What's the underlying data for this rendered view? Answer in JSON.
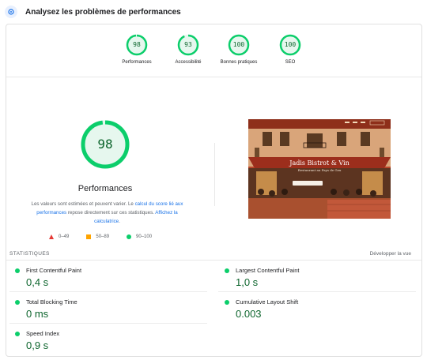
{
  "header": {
    "title": "Analysez les problèmes de performances",
    "icon": "lighthouse-icon"
  },
  "gauges": [
    {
      "label": "Performances",
      "value": "98",
      "score": 0.98
    },
    {
      "label": "Accessibilité",
      "value": "93",
      "score": 0.93
    },
    {
      "label": "Bonnes pratiques",
      "value": "100",
      "score": 1.0
    },
    {
      "label": "SEO",
      "value": "100",
      "score": 1.0
    }
  ],
  "main": {
    "score": "98",
    "score_fraction": 0.98,
    "label": "Performances",
    "desc_part1": "Les valeurs sont estimées et peuvent varier. Le ",
    "desc_link1": "calcul du score lié aux performances",
    "desc_part2": " repose directement sur ces statistiques. ",
    "desc_link2": "Affichez la calculatrice",
    "desc_part3": "."
  },
  "legend": [
    {
      "shape": "triangle",
      "text": "0–49",
      "color": "#e53935"
    },
    {
      "shape": "square",
      "text": "50–89",
      "color": "#ffa400"
    },
    {
      "shape": "circle",
      "text": "90–100",
      "color": "#0cce6b"
    }
  ],
  "screenshot": {
    "site_title": "Jadis Bistrot & Vin",
    "site_subtitle": "Restaurant au Pays de Gex"
  },
  "stats": {
    "title": "STATISTIQUES",
    "expand_label": "Développer la vue",
    "metrics": [
      {
        "label": "First Contentful Paint",
        "value": "0,4 s"
      },
      {
        "label": "Largest Contentful Paint",
        "value": "1,0 s"
      },
      {
        "label": "Total Blocking Time",
        "value": "0 ms"
      },
      {
        "label": "Cumulative Layout Shift",
        "value": "0.003"
      },
      {
        "label": "Speed Index",
        "value": "0,9 s"
      }
    ]
  },
  "colors": {
    "good": "#0cce6b",
    "good_text": "#0d652d",
    "good_bg": "#e6f7ee",
    "link": "#1a73e8"
  }
}
